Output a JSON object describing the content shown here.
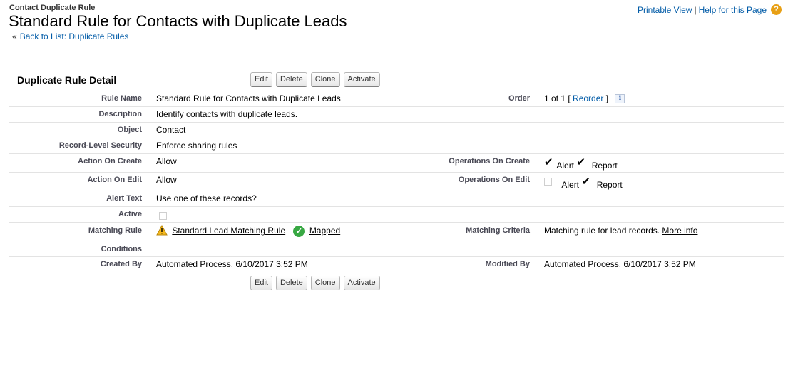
{
  "header": {
    "type_label": "Contact Duplicate Rule",
    "title": "Standard Rule for Contacts with Duplicate Leads",
    "back_prefix": "«",
    "back_link": "Back to List: Duplicate Rules",
    "printable_view": "Printable View",
    "separator": "|",
    "help_link": "Help for this Page",
    "help_icon": "?"
  },
  "section": {
    "title": "Duplicate Rule Detail"
  },
  "buttons": {
    "edit": "Edit",
    "delete": "Delete",
    "clone": "Clone",
    "activate": "Activate"
  },
  "fields": {
    "rule_name": {
      "label": "Rule Name",
      "value": "Standard Rule for Contacts with Duplicate Leads"
    },
    "order": {
      "label": "Order",
      "value_prefix": "1 of 1 [",
      "link": "Reorder",
      "value_suffix": "]",
      "info_icon": "i"
    },
    "description": {
      "label": "Description",
      "value": "Identify contacts with duplicate leads."
    },
    "object": {
      "label": "Object",
      "value": "Contact"
    },
    "record_level_security": {
      "label": "Record-Level Security",
      "value": "Enforce sharing rules"
    },
    "action_on_create": {
      "label": "Action On Create",
      "value": "Allow"
    },
    "operations_on_create": {
      "label": "Operations On Create",
      "alert": "Alert",
      "report": "Report",
      "alert_checked": true,
      "report_checked": true
    },
    "action_on_edit": {
      "label": "Action On Edit",
      "value": "Allow"
    },
    "operations_on_edit": {
      "label": "Operations On Edit",
      "alert": "Alert",
      "report": "Report",
      "alert_checked": false,
      "report_checked": true
    },
    "alert_text": {
      "label": "Alert Text",
      "value": "Use one of these records?"
    },
    "active": {
      "label": "Active",
      "checked": false
    },
    "matching_rule": {
      "label": "Matching Rule",
      "link": "Standard Lead Matching Rule",
      "status": "Mapped"
    },
    "matching_criteria": {
      "label": "Matching Criteria",
      "value": "Matching rule for lead records.",
      "link": "More info"
    },
    "conditions": {
      "label": "Conditions",
      "value": ""
    },
    "created_by": {
      "label": "Created By",
      "value": "Automated Process, 6/10/2017 3:52 PM"
    },
    "modified_by": {
      "label": "Modified By",
      "value": "Automated Process, 6/10/2017 3:52 PM"
    }
  },
  "colors": {
    "link": "#015ba7",
    "label": "#4a4a56",
    "warning": "#e8a015",
    "success": "#38a843"
  },
  "icons": {
    "warning": "warning-icon",
    "mapped": "check-circle-icon",
    "checked": "checkmark-icon",
    "help": "help-icon",
    "info": "info-icon"
  }
}
